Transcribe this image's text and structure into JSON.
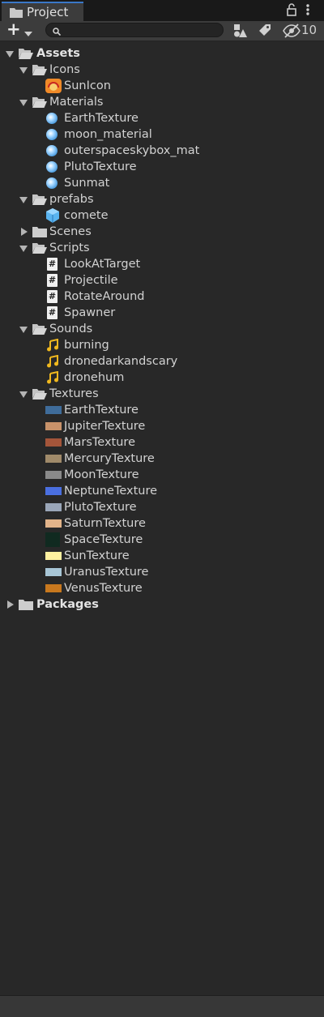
{
  "window": {
    "tab_label": "Project",
    "hidden_count": "10"
  },
  "search": {
    "placeholder": "",
    "value": ""
  },
  "icons": {
    "tab": "folder-icon",
    "lock": "lock-icon",
    "menu": "kebab-menu-icon",
    "create": "plus-icon",
    "search": "search-icon",
    "filter_type": "filter-by-type-icon",
    "filter_label": "filter-by-label-icon",
    "toggle_hidden": "eye-slash-icon"
  },
  "tree": {
    "assets": "Assets",
    "icons_folder": "Icons",
    "sunicon": "SunIcon",
    "materials_folder": "Materials",
    "materials": [
      "EarthTexture",
      "moon_material",
      "outerspaceskybox_mat",
      "PlutoTexture",
      "Sunmat"
    ],
    "prefabs_folder": "prefabs",
    "comete": "comete",
    "scenes_folder": "Scenes",
    "scripts_folder": "Scripts",
    "scripts": [
      "LookAtTarget",
      "Projectile",
      "RotateAround",
      "Spawner"
    ],
    "sounds_folder": "Sounds",
    "sounds": [
      "burning",
      "dronedarkandscary",
      "dronehum"
    ],
    "textures_folder": "Textures",
    "textures": [
      "EarthTexture",
      "JupiterTexture",
      "MarsTexture",
      "MercuryTexture",
      "MoonTexture",
      "NeptuneTexture",
      "PlutoTexture",
      "SaturnTexture",
      "SpaceTexture",
      "SunTexture",
      "UranusTexture",
      "VenusTexture"
    ],
    "texture_colors": [
      "#3f6c9a",
      "#c8926a",
      "#a4553a",
      "#a08a6a",
      "#8a8a8a",
      "#4a6fe0",
      "#9aa6b8",
      "#e2b48a",
      "#102a20",
      "#fff1a0",
      "#a8c6d6",
      "#c8781e"
    ],
    "packages": "Packages"
  },
  "colors": {
    "accent": "#3a78c8",
    "background": "#282828",
    "toolbar": "#3c3c3c",
    "sound": "#f0b81e",
    "prefab": "#5ab4f0"
  }
}
